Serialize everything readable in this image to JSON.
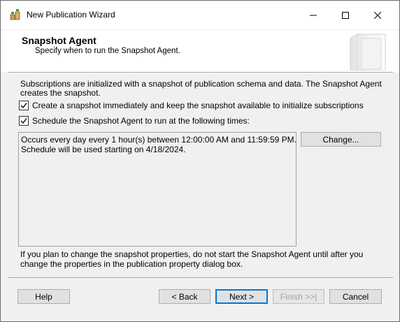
{
  "window": {
    "title": "New Publication Wizard"
  },
  "header": {
    "title": "Snapshot Agent",
    "subtitle": "Specify when to run the Snapshot Agent."
  },
  "intro_text": "Subscriptions are initialized with a snapshot of publication schema and data. The Snapshot Agent creates the snapshot.",
  "options": {
    "create_snapshot": {
      "label": "Create a snapshot immediately and keep the snapshot available to initialize subscriptions",
      "checked": true
    },
    "schedule_agent": {
      "label": "Schedule the Snapshot Agent to run at the following times:",
      "checked": true
    }
  },
  "schedule": {
    "line1": "Occurs every day every 1 hour(s) between 12:00:00 AM and 11:59:59 PM.",
    "line2": "Schedule will be used starting on 4/18/2024.",
    "change_label": "Change..."
  },
  "note_text": "If you plan to change the snapshot properties, do not start the Snapshot Agent until after you change the properties in the publication property dialog box.",
  "buttons": {
    "help": "Help",
    "back": "< Back",
    "next": "Next >",
    "finish": "Finish >>|",
    "cancel": "Cancel"
  },
  "colors": {
    "dialog_bg": "#f0f0f0",
    "accent": "#0078d7"
  }
}
